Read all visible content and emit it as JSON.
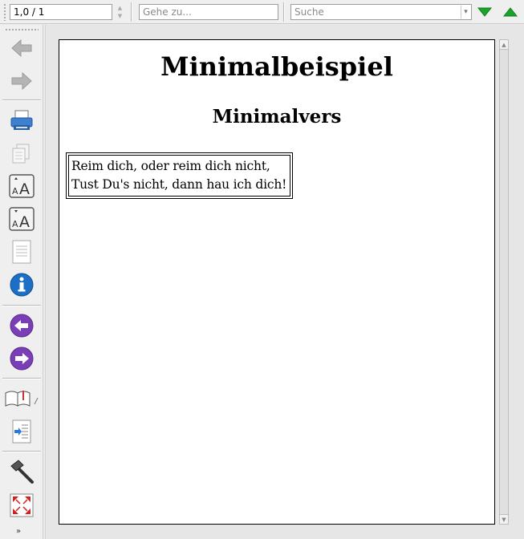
{
  "toolbar": {
    "page_value": "1,0 / 1",
    "goto_placeholder": "Gehe zu...",
    "search_placeholder": "Suche",
    "search_next_icon": "arrow-down-icon",
    "search_prev_icon": "arrow-up-icon"
  },
  "sidebar_tools": [
    "back-icon",
    "forward-icon",
    "print-icon",
    "copy-icon",
    "zoom-in-icon",
    "zoom-out-icon",
    "page-icon",
    "info-icon",
    "previous-icon",
    "next-icon",
    "bookmark-book-icon",
    "toc-icon",
    "build-hammer-icon",
    "fullscreen-icon",
    "more-chevron-icon"
  ],
  "document": {
    "title": "Minimalbeispiel",
    "subtitle": "Minimalvers",
    "verse": {
      "line1": "Reim dich, oder reim dich nicht,",
      "line2": "Tust Du's nicht, dann hau ich dich!"
    }
  },
  "colors": {
    "toolbar_bg": "#efefef",
    "page_bg": "#ffffff",
    "nav_arrow_green": "#1aa52a",
    "info_blue": "#1b6fc4",
    "nav_purple": "#7a3fb6"
  }
}
